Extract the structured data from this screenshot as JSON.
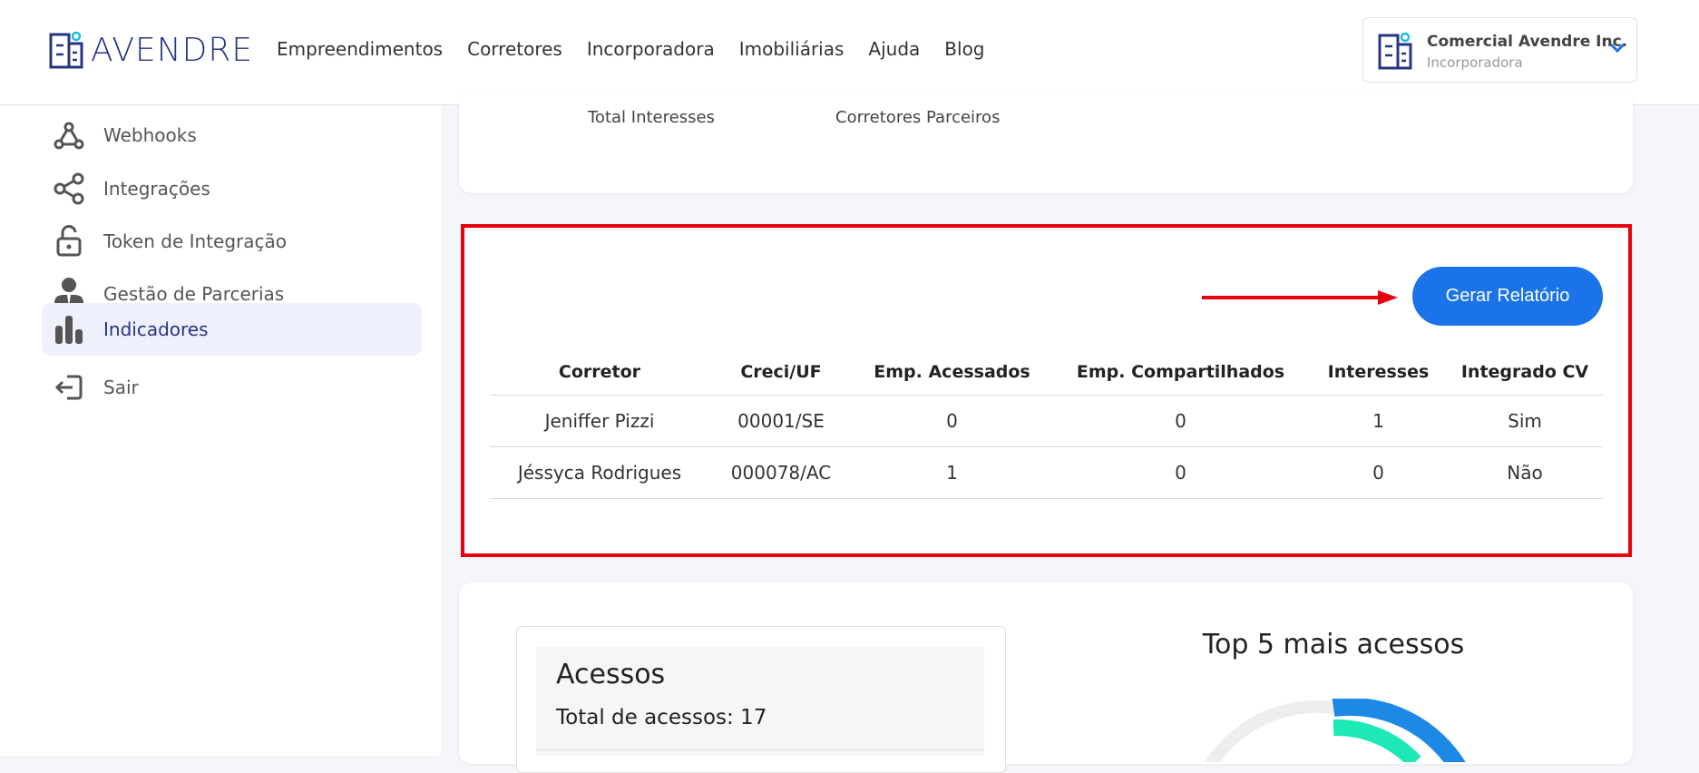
{
  "header": {
    "logo_text": "AVENDRE",
    "nav": [
      "Empreendimentos",
      "Corretores",
      "Incorporadora",
      "Imobiliárias",
      "Ajuda",
      "Blog"
    ],
    "company": {
      "name": "Comercial Avendre Inc.",
      "role": "Incorporadora"
    }
  },
  "sidebar": {
    "items": [
      {
        "label": "Webhooks",
        "icon": "webhook-icon"
      },
      {
        "label": "Integrações",
        "icon": "share-icon"
      },
      {
        "label": "Token de Integração",
        "icon": "unlock-icon"
      },
      {
        "label": "Gestão de Parcerias",
        "icon": "person-icon"
      },
      {
        "label": "Indicadores",
        "icon": "bar-chart-icon",
        "active": true
      },
      {
        "label": "Sair",
        "icon": "logout-icon"
      }
    ]
  },
  "stats": {
    "labels": [
      "Total Interesses",
      "Corretores Parceiros"
    ]
  },
  "report": {
    "button_label": "Gerar Relatório",
    "columns": [
      "Corretor",
      "Creci/UF",
      "Emp. Acessados",
      "Emp. Compartilhados",
      "Interesses",
      "Integrado CV"
    ],
    "rows": [
      [
        "Jeniffer Pizzi",
        "00001/SE",
        "0",
        "0",
        "1",
        "Sim"
      ],
      [
        "Jéssyca Rodrigues",
        "000078/AC",
        "1",
        "0",
        "0",
        "Não"
      ]
    ]
  },
  "acessos": {
    "title": "Acessos",
    "total_label": "Total de acessos: 17"
  },
  "top5": {
    "title": "Top 5 mais acessos"
  },
  "colors": {
    "accent": "#1a73e8",
    "brand": "#283580",
    "highlight": "#e8000d"
  }
}
